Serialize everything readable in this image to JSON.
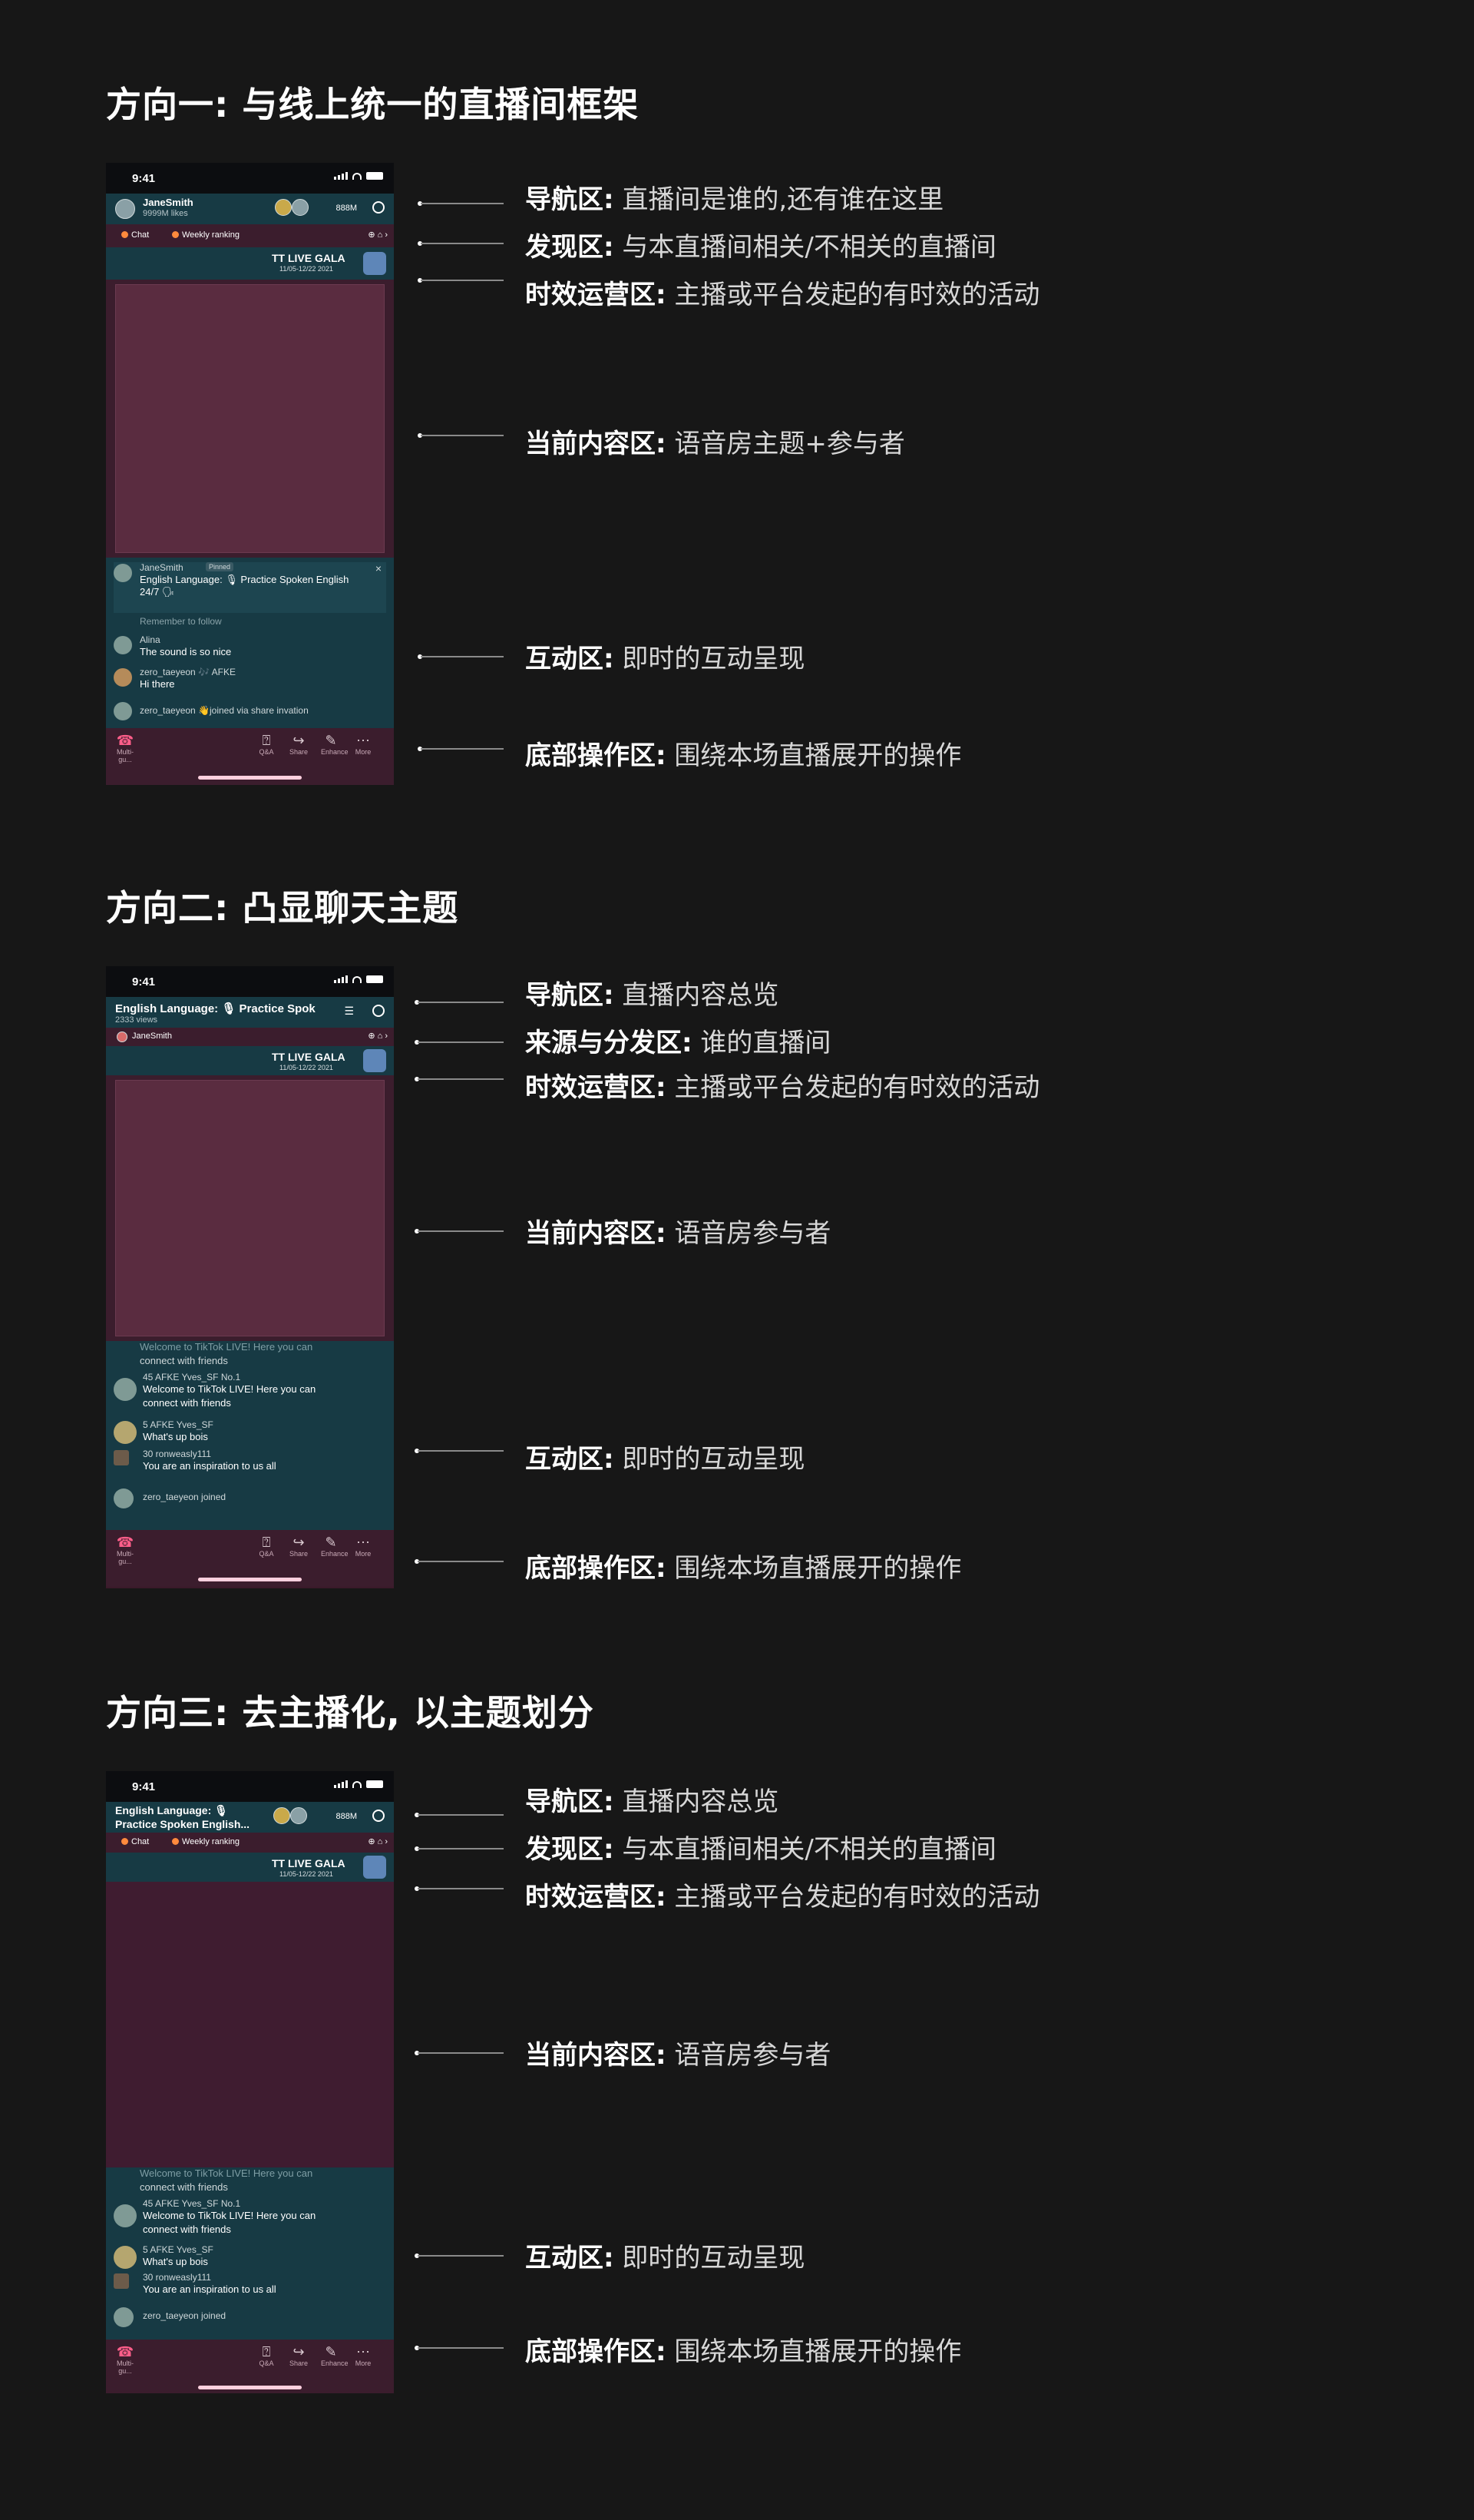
{
  "sections": [
    {
      "title": "方向一: 与线上统一的直播间框架"
    },
    {
      "title": "方向二: 凸显聊天主题"
    },
    {
      "title": "方向三: 去主播化, 以主题划分"
    }
  ],
  "status_time": "9:41",
  "phone1": {
    "nav_name": "JaneSmith",
    "nav_likes": "9999M likes",
    "nav_count": "888M",
    "disc_chat": "Chat",
    "disc_rank": "Weekly ranking",
    "gala_title": "TT LIVE GALA",
    "gala_date": "11/05-12/22 2021",
    "pinned_user": "JaneSmith",
    "pinned_tag": "Pinned",
    "pinned_text": "English Language: 🎙 Practice Spoken English",
    "pinned_text2": "24/7 🗣",
    "remember": "Remember to follow",
    "m1_user": "Alina",
    "m1_text": "The sound is so nice",
    "m2_user": "zero_taeyeon 🎶 AFKE",
    "m2_text": "Hi there",
    "m3_text": "zero_taeyeon 👋joined via share invation"
  },
  "phone2": {
    "nav_title": "English Language: 🎙 Practice Spok",
    "nav_views": "2333 views",
    "host": "JaneSmith",
    "gala_title": "TT LIVE GALA",
    "gala_date": "11/05-12/22 2021",
    "welcome_faded": "Welcome to TikTok LIVE! Here you can",
    "welcome_faded2": "connect with friends",
    "m1_user": "45  AFKE  Yves_SF  No.1",
    "m1_text": "Welcome to TikTok LIVE! Here you can",
    "m1_text2": "connect with friends",
    "m2_user": "5  AFKE  Yves_SF",
    "m2_text": "What's up bois",
    "m3_user": "30  ronweasly111",
    "m3_text": "You are an inspiration to us all",
    "m4_text": "zero_taeyeon  joined"
  },
  "phone3": {
    "nav_title": "English Language: 🎙",
    "nav_title2": "Practice Spoken English...",
    "nav_count": "888M",
    "disc_chat": "Chat",
    "disc_rank": "Weekly ranking",
    "gala_title": "TT LIVE GALA",
    "gala_date": "11/05-12/22 2021",
    "welcome_faded": "Welcome to TikTok LIVE! Here you can",
    "welcome_faded2": "connect with friends",
    "m1_user": "45  AFKE  Yves_SF  No.1",
    "m1_text": "Welcome to TikTok LIVE! Here you can",
    "m1_text2": "connect with friends",
    "m2_user": "5  AFKE  Yves_SF",
    "m2_text": "What's up bois",
    "m3_user": "30  ronweasly111",
    "m3_text": "You are an inspiration to us all",
    "m4_text": "zero_taeyeon  joined"
  },
  "bottom": {
    "multi": "Multi-gu...",
    "qa": "Q&A",
    "share": "Share",
    "enhance": "Enhance",
    "more": "More"
  },
  "labels1": [
    {
      "k": "导航区:",
      "v": " 直播间是谁的,还有谁在这里"
    },
    {
      "k": "发现区:",
      "v": " 与本直播间相关/不相关的直播间"
    },
    {
      "k": "时效运营区:",
      "v": " 主播或平台发起的有时效的活动"
    },
    {
      "k": "当前内容区:",
      "v": " 语音房主题+参与者"
    },
    {
      "k": "互动区:",
      "v": " 即时的互动呈现"
    },
    {
      "k": "底部操作区:",
      "v": " 围绕本场直播展开的操作"
    }
  ],
  "labels2": [
    {
      "k": "导航区:",
      "v": " 直播内容总览"
    },
    {
      "k": "来源与分发区:",
      "v": " 谁的直播间"
    },
    {
      "k": "时效运营区:",
      "v": " 主播或平台发起的有时效的活动"
    },
    {
      "k": "当前内容区:",
      "v": " 语音房参与者"
    },
    {
      "k": "互动区:",
      "v": " 即时的互动呈现"
    },
    {
      "k": "底部操作区:",
      "v": " 围绕本场直播展开的操作"
    }
  ],
  "labels3": [
    {
      "k": "导航区:",
      "v": " 直播内容总览"
    },
    {
      "k": "发现区:",
      "v": " 与本直播间相关/不相关的直播间"
    },
    {
      "k": "时效运营区:",
      "v": " 主播或平台发起的有时效的活动"
    },
    {
      "k": "当前内容区:",
      "v": " 语音房参与者"
    },
    {
      "k": "互动区:",
      "v": " 即时的互动呈现"
    },
    {
      "k": "底部操作区:",
      "v": " 围绕本场直播展开的操作"
    }
  ]
}
